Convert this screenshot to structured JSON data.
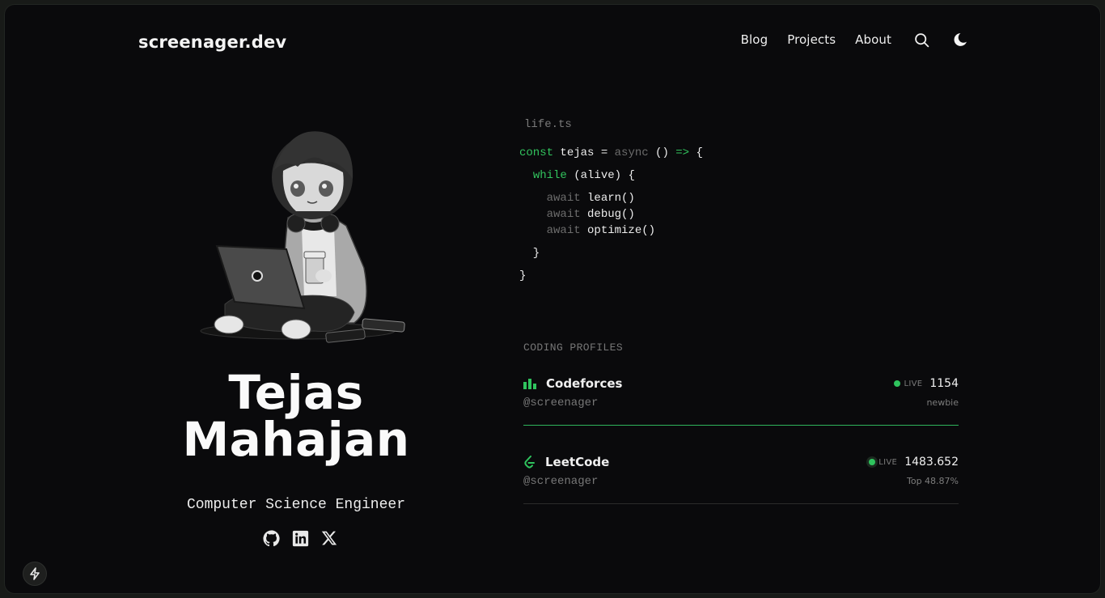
{
  "header": {
    "logo": "screenager.dev",
    "nav": [
      {
        "label": "Blog"
      },
      {
        "label": "Projects"
      },
      {
        "label": "About"
      }
    ],
    "icons": [
      "search-icon",
      "moon-icon"
    ]
  },
  "hero": {
    "avatar_alt": "illustration of a boy sitting with a laptop",
    "first_name": "Tejas",
    "last_name": "Mahajan",
    "subtitle": "Computer Science Engineer",
    "socials": [
      {
        "name": "GitHub",
        "icon": "github-icon"
      },
      {
        "name": "LinkedIn",
        "icon": "linkedin-icon"
      },
      {
        "name": "X",
        "icon": "x-icon"
      }
    ]
  },
  "code": {
    "filename": "life.ts",
    "tokens": {
      "const": "const",
      "var": " tejas = ",
      "async": "async",
      "parens": " () ",
      "arrow": "=>",
      "open": " {",
      "while_indent": "  ",
      "while": "while",
      "while_cond": " (alive) {",
      "await": "await",
      "call1": " learn()",
      "call2": " debug()",
      "call3": " optimize()",
      "indent4": "    ",
      "close_inner": "  }",
      "close_outer": "}"
    }
  },
  "profiles": {
    "heading": "CODING PROFILES",
    "items": [
      {
        "name": "Codeforces",
        "handle": "@screenager",
        "live_label": "LIVE",
        "rating": "1154",
        "rank": "newbie",
        "icon": "bar-chart-icon"
      },
      {
        "name": "LeetCode",
        "handle": "@screenager",
        "live_label": "LIVE",
        "rating": "1483.652",
        "rank": "Top 48.87%",
        "icon": "leetcode-icon"
      }
    ]
  },
  "colors": {
    "accent": "#2fc45e",
    "background": "#0a0a0c",
    "frame": "#181a18"
  },
  "corner_button": {
    "icon": "lightning-icon"
  }
}
